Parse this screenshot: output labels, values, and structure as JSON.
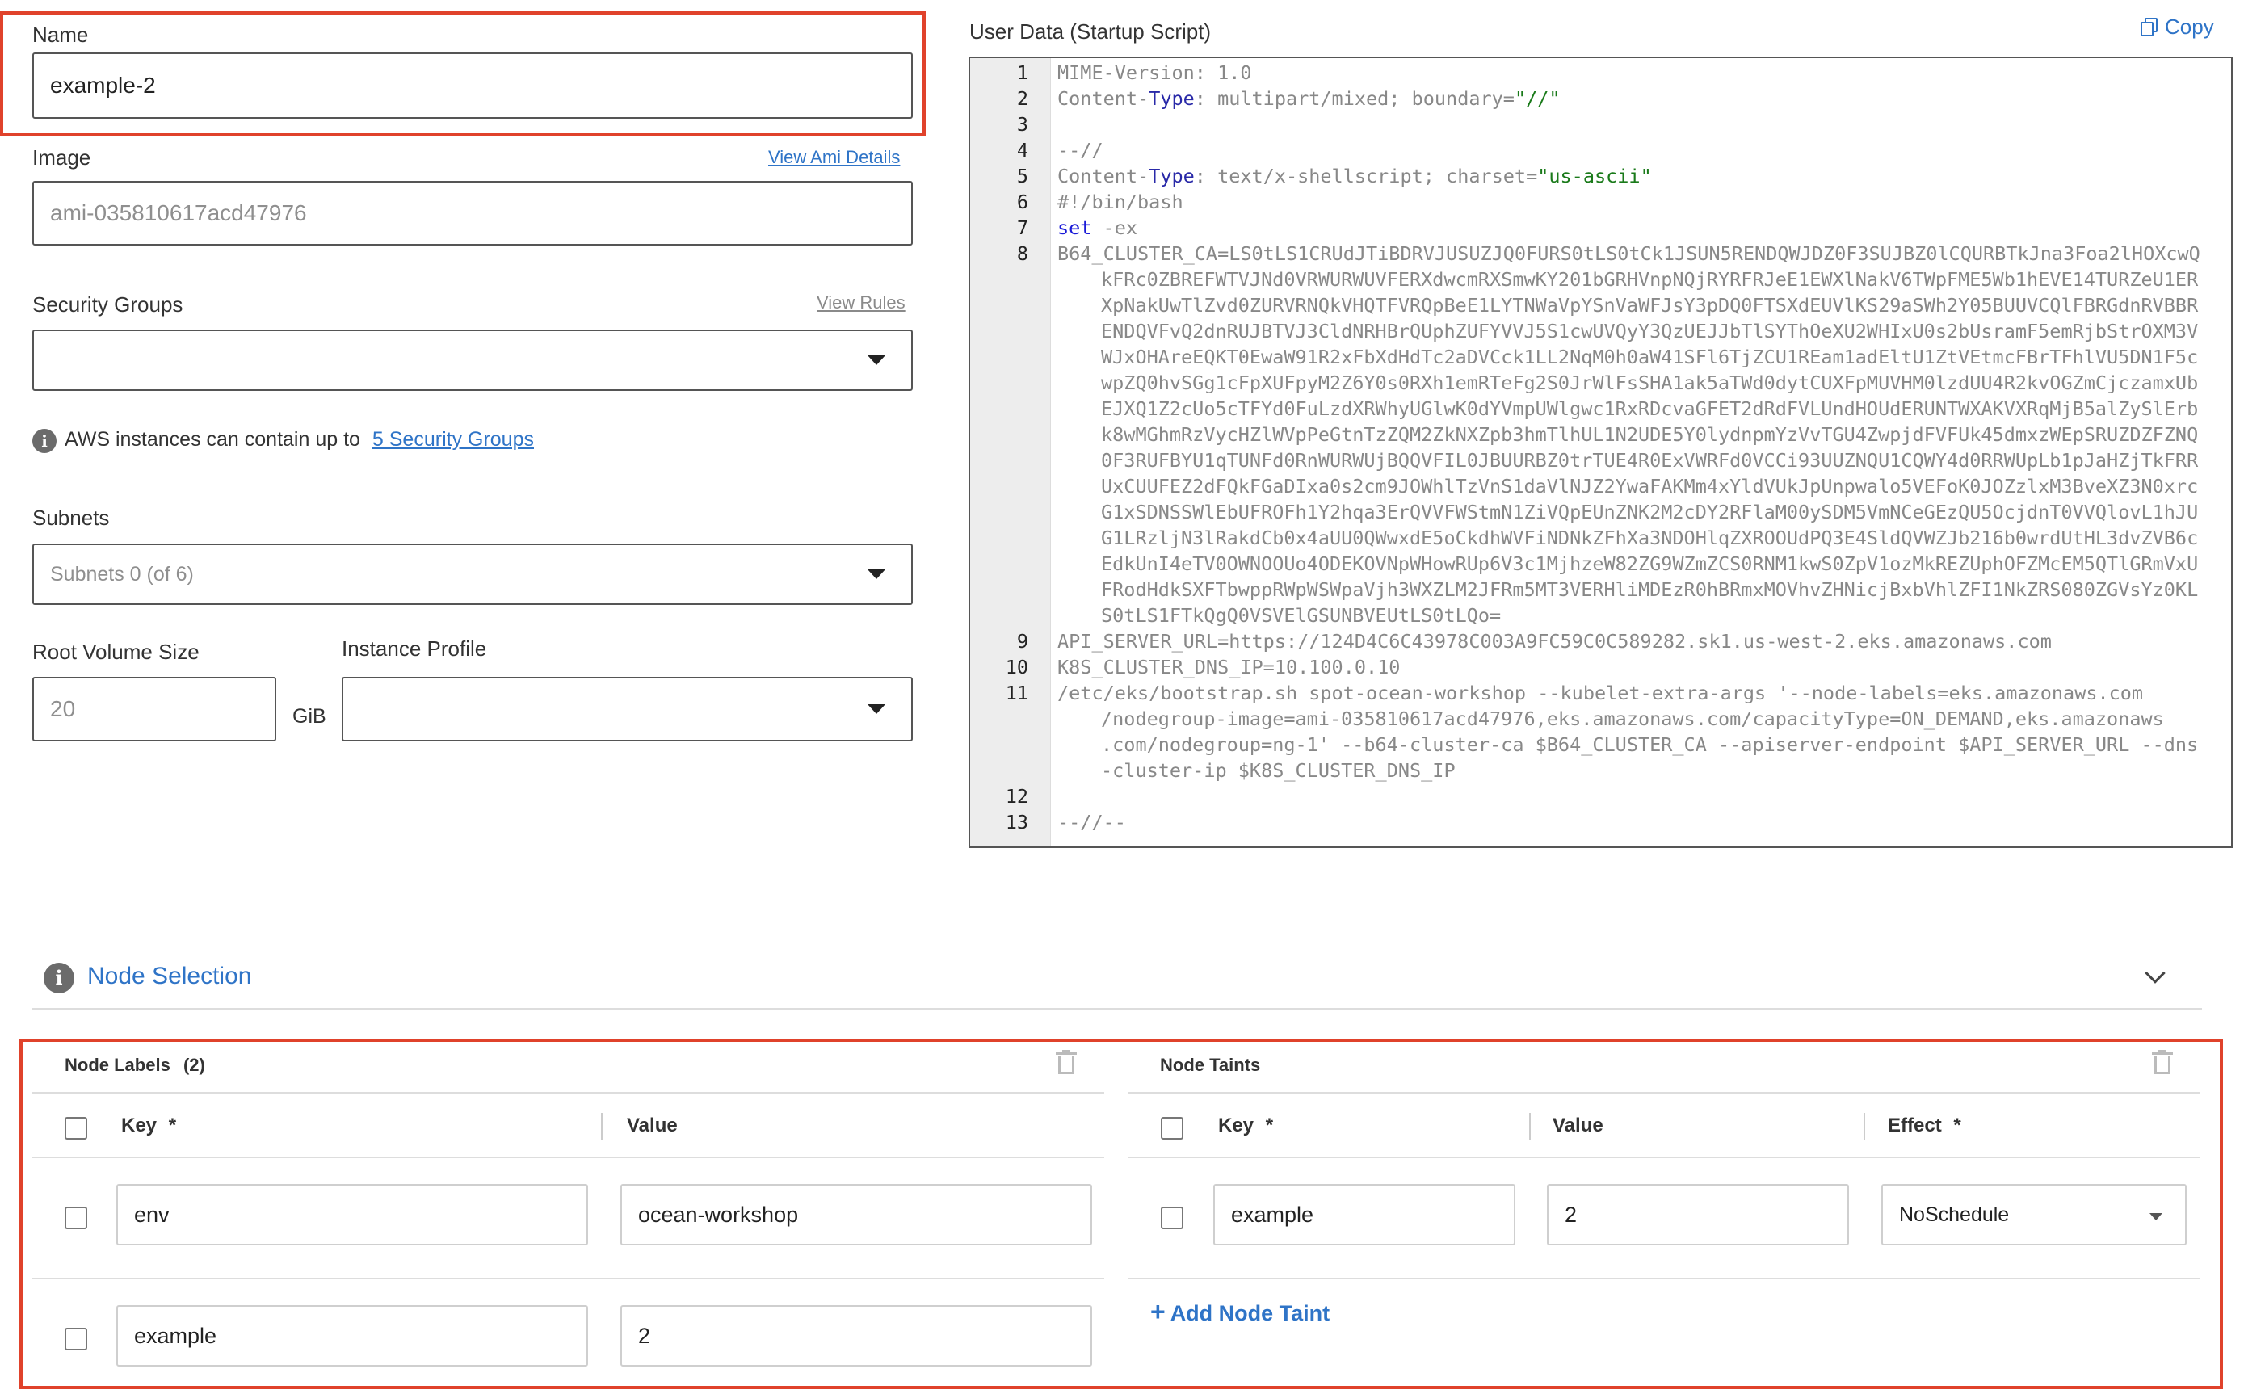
{
  "name": {
    "label": "Name",
    "value": "example-2"
  },
  "image": {
    "label": "Image",
    "link": "View Ami Details",
    "value": "ami-035810617acd47976"
  },
  "security_groups": {
    "label": "Security Groups",
    "link": "View Rules",
    "value": ""
  },
  "info": {
    "text": "AWS instances can contain up to",
    "link": "5 Security Groups"
  },
  "subnets": {
    "label": "Subnets",
    "placeholder": "Subnets 0 (of 6)"
  },
  "root_volume": {
    "label": "Root Volume Size",
    "value": "20",
    "unit": "GiB"
  },
  "instance_profile": {
    "label": "Instance Profile",
    "value": ""
  },
  "user_data": {
    "label": "User Data (Startup Script)",
    "copy_label": "Copy",
    "line_numbers": [
      "1",
      "2",
      "3",
      "4",
      "5",
      "6",
      "7",
      "8",
      "9",
      "10",
      "11",
      "12",
      "13"
    ],
    "lines": {
      "l1": "MIME-Version: 1.0",
      "l2a": "Content-",
      "l2b": "Type",
      "l2c": ": multipart/mixed; boundary=",
      "l2d": "\"//\"",
      "l3": "",
      "l4": "--//",
      "l5a": "Content-",
      "l5b": "Type",
      "l5c": ": text/x-shellscript; charset=",
      "l5d": "\"us-ascii\"",
      "l6": "#!/bin/bash",
      "l7a": "set",
      "l7b": " -ex",
      "l8": "B64_CLUSTER_CA=LS0tLS1CRUdJTiBDRVJUSUZJQ0FURS0tLS0tCk1JSUN5RENDQWJDZ0F3SUJBZ0lCQURBTkJna3Foa2lHOXcwQ",
      "l8_wrap": [
        "kFRc0ZBREFWTVJNd0VRWURWUVFERXdwcmRXSmwKY201bGRHVnpNQjRYRFRJeE1EWXlNakV6TWpFME5Wb1hEVE14TURZeU1ER",
        "XpNakUwTlZvd0ZURVRNQkVHQTFVRQpBeE1LYTNWaVpYSnVaWFJsY3pDQ0FTSXdEUVlKS29aSWh2Y05BUUVCQlFBRGdnRVBBR",
        "ENDQVFvQ2dnRUJBTVJ3CldNRHBrQUphZUFYVVJ5S1cwUVQyY3QzUEJJbTlSYThOeXU2WHIxU0s2bUsramF5emRjbStrOXM3V",
        "WJxOHAreEQKT0EwaW91R2xFbXdHdTc2aDVCck1LL2NqM0h0aW41SFl6TjZCU1REam1adEltU1ZtVEtmcFBrTFhlVU5DN1F5c",
        "wpZQ0hvSGg1cFpXUFpyM2Z6Y0s0RXh1emRTeFg2S0JrWlFsSHA1ak5aTWd0dytCUXFpMUVHM0lzdUU4R2kvOGZmCjczamxUb",
        "EJXQ1Z2cUo5cTFYd0FuLzdXRWhyUGlwK0dYVmpUWlgwc1RxRDcvaGFET2dRdFVLUndHOUdERUNTWXAKVXRqMjB5alZySlErb",
        "k8wMGhmRzVycHZlWVpPeGtnTzZQM2ZkNXZpb3hmTlhUL1N2UDE5Y0lydnpmYzVvTGU4ZwpjdFVFUk45dmxzWEpSRUZDZFZNQ",
        "0F3RUFBYU1qTUNFd0RnWURWUjBQQVFIL0JBUURBZ0trTUE4R0ExVWRFd0VCCi93UUZNQU1CQWY4d0RRWUpLb1pJaHZjTkFRR",
        "UxCUUFEZ2dFQkFGaDIxa0s2cm9JOWhlTzVnS1daVlNJZ2YwaFAKMm4xYldVUkJpUnpwalo5VEFoK0JOZzlxM3BveXZ3N0xrc",
        "G1xSDNSSWlEbUFROFh1Y2hqa3ErQVVFWStmN1ZiVQpEUnZNK2M2cDY2RFlaM00ySDM5VmNCeGEzQU5OcjdnT0VVQlovL1hJU",
        "G1LRzljN3lRakdCb0x4aUU0QWwxdE5oCkdhWVFiNDNkZFhXa3NDOHlqZXROOUdPQ3E4SldQVWZJb216b0wrdUtHL3dvZVB6c",
        "EdkUnI4eTV0OWNOOUo4ODEKOVNpWHowRUp6V3c1MjhzeW82ZG9WZmZCS0RNM1kwS0ZpV1ozMkREZUphOFZMcEM5QTlGRmVxU",
        "FRodHdkSXFTbwppRWpWSWpaVjh3WXZLM2JFRm5MT3VERHliMDEzR0hBRmxMOVhvZHNicjBxbVhlZFI1NkZRS080ZGVsYz0KL",
        "S0tLS1FTkQgQ0VSVElGSUNBVEUtLS0tLQo="
      ],
      "l9": "API_SERVER_URL=https://124D4C6C43978C003A9FC59C0C589282.sk1.us-west-2.eks.amazonaws.com",
      "l10": "K8S_CLUSTER_DNS_IP=10.100.0.10",
      "l11": "/etc/eks/bootstrap.sh spot-ocean-workshop --kubelet-extra-args '--node-labels=eks.amazonaws.com",
      "l11_wrap": [
        "/nodegroup-image=ami-035810617acd47976,eks.amazonaws.com/capacityType=ON_DEMAND,eks.amazonaws",
        ".com/nodegroup=ng-1' --b64-cluster-ca $B64_CLUSTER_CA --apiserver-endpoint $API_SERVER_URL --dns",
        "-cluster-ip $K8S_CLUSTER_DNS_IP"
      ],
      "l12": "",
      "l13": "--//--"
    }
  },
  "node_selection": {
    "label": "Node Selection"
  },
  "node_labels": {
    "title": "Node Labels",
    "count": "(2)",
    "col_key": "Key",
    "col_value": "Value",
    "required": "*",
    "rows": [
      {
        "key": "env",
        "value": "ocean-workshop"
      },
      {
        "key": "example",
        "value": "2"
      }
    ]
  },
  "node_taints": {
    "title": "Node Taints",
    "col_key": "Key",
    "col_value": "Value",
    "col_effect": "Effect",
    "required": "*",
    "rows": [
      {
        "key": "example",
        "value": "2",
        "effect": "NoSchedule"
      }
    ],
    "add_label": "Add Node Taint",
    "add_icon": "+"
  },
  "colors": {
    "accent": "#2f74c7",
    "highlight": "#e0422b"
  }
}
